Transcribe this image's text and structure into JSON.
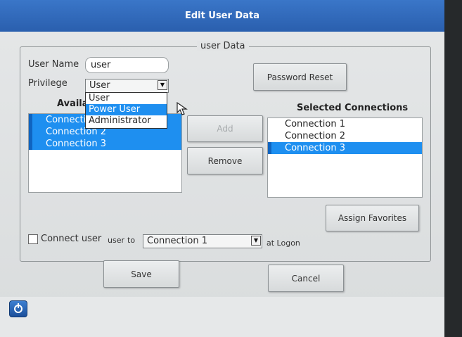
{
  "window": {
    "title": "Edit User Data"
  },
  "group": {
    "legend": "user Data"
  },
  "form": {
    "username_label": "User Name",
    "username_value": "user",
    "privilege_label": "Privilege",
    "privilege_value": "User",
    "privilege_options": [
      "User",
      "Power User",
      "Administrator"
    ],
    "privilege_highlighted": "Power User"
  },
  "buttons": {
    "password_reset": "Password Reset",
    "add": "Add",
    "remove": "Remove",
    "assign_favorites": "Assign Favorites",
    "save": "Save",
    "cancel": "Cancel"
  },
  "available": {
    "heading": "Availal",
    "items": [
      "Connecti",
      "Connection 2",
      "Connection 3"
    ]
  },
  "selected": {
    "heading": "Selected Connections",
    "items": [
      "Connection 1",
      "Connection 2",
      "Connection 3"
    ],
    "selected_item": "Connection 3"
  },
  "logon": {
    "checkbox_label": "Connect user",
    "user_text": "user",
    "to_text": "to",
    "connection_value": "Connection 1",
    "suffix": "at Logon"
  },
  "icons": {
    "dropdown": "chevron-down-icon",
    "app": "power-icon",
    "cursor": "arrow-cursor-icon"
  },
  "colors": {
    "title_bar": "#2f68b8",
    "selection": "#1e8ff0"
  }
}
